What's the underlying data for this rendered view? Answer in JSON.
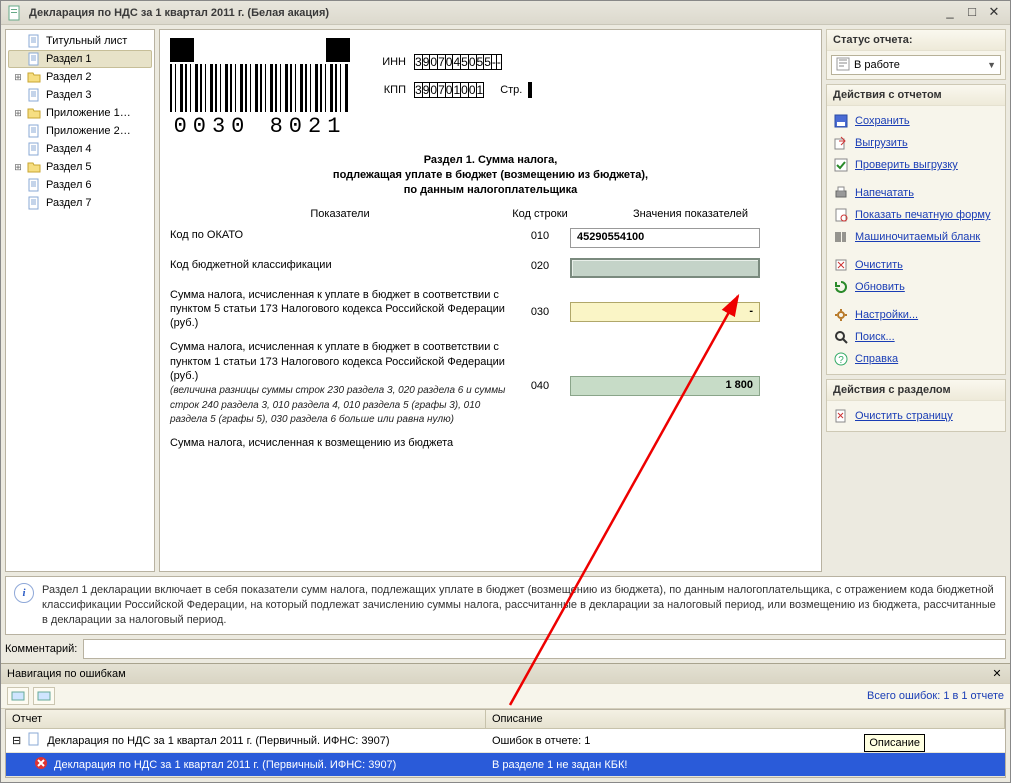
{
  "window": {
    "title": "Декларация по НДС за 1 квартал 2011 г. (Белая акация)"
  },
  "tree": {
    "items": [
      {
        "label": "Титульный лист",
        "type": "doc"
      },
      {
        "label": "Раздел 1",
        "type": "doc",
        "selected": true
      },
      {
        "label": "Раздел 2",
        "type": "folder",
        "expandable": true
      },
      {
        "label": "Раздел 3",
        "type": "doc",
        "indent": 1
      },
      {
        "label": "Приложение 1…",
        "type": "folder",
        "expandable": true
      },
      {
        "label": "Приложение 2…",
        "type": "doc",
        "indent": 1
      },
      {
        "label": "Раздел 4",
        "type": "doc",
        "indent": 1
      },
      {
        "label": "Раздел 5",
        "type": "folder",
        "expandable": true
      },
      {
        "label": "Раздел 6",
        "type": "doc",
        "indent": 1
      },
      {
        "label": "Раздел 7",
        "type": "doc",
        "indent": 1
      }
    ]
  },
  "barcode": {
    "number": "0030 8021"
  },
  "codes": {
    "inn_label": "ИНН",
    "inn": [
      "3",
      "9",
      "0",
      "7",
      "0",
      "4",
      "5",
      "0",
      "5",
      "5",
      "-",
      "-"
    ],
    "kpp_label": "КПП",
    "kpp": [
      "3",
      "9",
      "0",
      "7",
      "0",
      "1",
      "0",
      "0",
      "1"
    ],
    "page_label": "Стр.",
    "page": [
      "",
      "",
      ""
    ]
  },
  "section": {
    "title_l1": "Раздел 1. Сумма налога,",
    "title_l2": "подлежащая уплате в бюджет (возмещению из бюджета),",
    "title_l3": "по данным налогоплательщика",
    "col_desc": "Показатели",
    "col_code": "Код строки",
    "col_val": "Значения показателей",
    "rows": [
      {
        "label": "Код по ОКАТО",
        "code": "010",
        "value": "45290554100",
        "style": "bold"
      },
      {
        "label": "Код бюджетной классификации",
        "code": "020",
        "value": "",
        "style": "gray"
      },
      {
        "label": "Сумма налога, исчисленная к уплате в бюджет в соответствии с пунктом 5 статьи 173 Налогового кодекса Российской Федерации (руб.)",
        "code": "030",
        "value": "-",
        "style": "yellow"
      },
      {
        "label": "Сумма налога, исчисленная к уплате в бюджет в соответствии с пунктом 1 статьи 173 Налогового кодекса Российской Федерации (руб.)",
        "note": "(величина разницы суммы строк 230 раздела 3, 020 раздела 6 и суммы строк 240 раздела 3, 010 раздела 4, 010 раздела 5 (графы 3), 010 раздела 5 (графы 5), 030 раздела 6 больше или равна нулю)",
        "code": "040",
        "value": "1 800",
        "style": "green"
      },
      {
        "label": "Сумма налога, исчисленная к возмещению из бюджета",
        "code": "",
        "value": "",
        "style": "cut"
      }
    ]
  },
  "info": "Раздел 1 декларации включает в себя показатели сумм налога, подлежащих уплате в бюджет (возмещению из бюджета), по данным налогоплательщика, с отражением кода бюджетной классификации Российской Федерации, на который подлежат зачислению суммы налога, рассчитанные в декларации за налоговый период, или возмещению из бюджета, рассчитанные в декларации за  налоговый период.",
  "comment_label": "Комментарий:",
  "side": {
    "status_heading": "Статус отчета:",
    "status_value": "В работе",
    "actions_heading": "Действия с отчетом",
    "links1": [
      "Сохранить",
      "Выгрузить",
      "Проверить выгрузку"
    ],
    "links2": [
      "Напечатать",
      "Показать печатную форму",
      "Машиночитаемый бланк"
    ],
    "links3": [
      "Очистить",
      "Обновить"
    ],
    "links4": [
      "Настройки...",
      "Поиск...",
      "Справка"
    ],
    "section_heading": "Действия с разделом",
    "links5": [
      "Очистить страницу"
    ]
  },
  "errors": {
    "title": "Навигация по ошибкам",
    "count": "Всего ошибок: 1 в 1 отчете",
    "col_report": "Отчет",
    "col_desc": "Описание",
    "tooltip": "Описание",
    "rows": [
      {
        "report": "Декларация по НДС за 1 квартал 2011 г. (Первичный. ИФНС: 3907)",
        "desc": "Ошибок в отчете: 1",
        "parent": true
      },
      {
        "report": "Декларация по НДС за 1 квартал 2011 г. (Первичный. ИФНС: 3907)",
        "desc": "В разделе 1 не задан КБК!",
        "child": true,
        "selected": true
      }
    ]
  }
}
